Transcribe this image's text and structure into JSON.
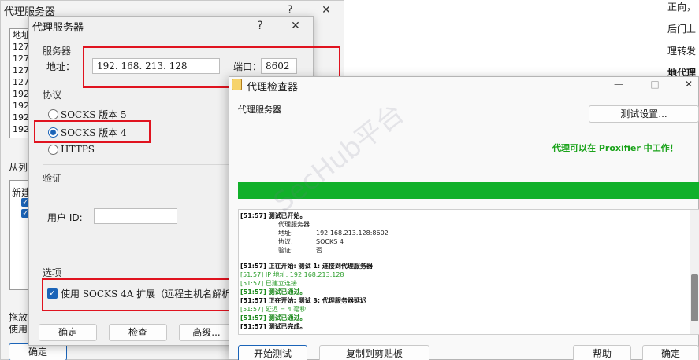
{
  "back_window": {
    "title": "代理服务器",
    "help_btn": "?",
    "close_btn": "✕",
    "list_header": "地址",
    "list_rows": [
      "127.",
      "127.",
      "127.",
      "127.",
      "192.",
      "192.",
      "192.",
      "192."
    ],
    "from_list_text": "从列",
    "new_label": "新建",
    "drag_hint_1": "拖放",
    "drag_hint_2": "使用",
    "ok_btn": "确定"
  },
  "right_text": {
    "line1": "正向，",
    "line2": "后门上",
    "line3": "理转发",
    "line4": "地代理"
  },
  "proxy_dialog": {
    "title": "代理服务器",
    "help_btn": "?",
    "close_btn": "✕",
    "server_section": "服务器",
    "address_label": "地址：",
    "address_value": "192. 168. 213. 128",
    "port_label": "端口：",
    "port_value": "8602",
    "protocol_section": "协议",
    "protocols": [
      "SOCKS 版本 5",
      "SOCKS 版本 4",
      "HTTPS"
    ],
    "selected_protocol": "SOCKS 版本 4",
    "auth_section": "验证",
    "user_id_label": "用户 ID:",
    "user_id_value": "",
    "options_section": "选项",
    "socks4a_checkbox": "使用 SOCKS 4A 扩展（远程主机名解析功",
    "ok_btn": "确定",
    "check_btn": "检查",
    "advanced_btn": "高级..."
  },
  "checker_window": {
    "title": "代理检查器",
    "minimize_btn": "—",
    "maximize_btn": "□",
    "close_btn": "✕",
    "proxy_server_label": "代理服务器",
    "test_settings_btn": "测试设置...",
    "status_message": "代理可以在 Proxifier 中工作！",
    "progress": 1.0,
    "log": [
      {
        "style": "bold",
        "text": "[51:57] 测试已开始。"
      },
      {
        "style": "indent",
        "text": "代理服务器"
      },
      {
        "style": "kv",
        "key": "地址:",
        "value": "192.168.213.128:8602"
      },
      {
        "style": "kv",
        "key": "协议:",
        "value": "SOCKS 4"
      },
      {
        "style": "kv",
        "key": "验证:",
        "value": "否"
      },
      {
        "style": "blank",
        "text": ""
      },
      {
        "style": "bold",
        "text": "[51:57] 正在开始: 测试 1: 连接到代理服务器"
      },
      {
        "style": "green",
        "text": "[51:57] IP 地址: 192.168.213.128"
      },
      {
        "style": "green",
        "text": "[51:57] 已建立连接"
      },
      {
        "style": "greenb",
        "text": "[51:57] 测试已通过。"
      },
      {
        "style": "bold",
        "text": "[51:57] 正在开始: 测试 3: 代理服务器延迟"
      },
      {
        "style": "green",
        "text": "[51:57] 延迟 = 4 毫秒"
      },
      {
        "style": "greenb",
        "text": "[51:57] 测试已通过。"
      },
      {
        "style": "bold",
        "text": "[51:57] 测试已完成。"
      }
    ],
    "start_test_btn": "开始测试",
    "copy_btn": "复制到剪贴板",
    "help_btn": "帮助",
    "ok_btn": "确定"
  },
  "watermark": "SecHub平台",
  "colors": {
    "success_green": "#11b02a",
    "highlight_red": "#e0131f",
    "accent_blue": "#1b64b8"
  }
}
